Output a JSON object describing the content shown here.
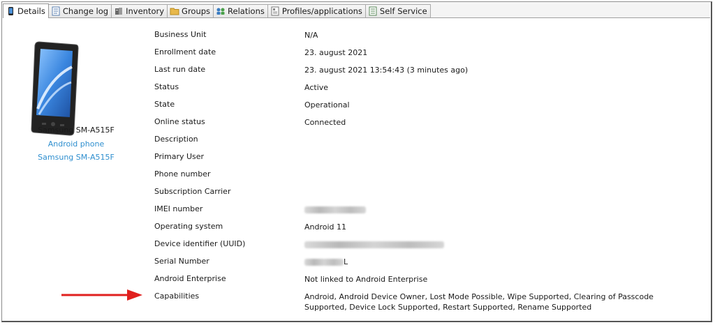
{
  "tabs": [
    {
      "label": "Details",
      "icon": "phone-icon",
      "active": true
    },
    {
      "label": "Change log",
      "icon": "document-icon"
    },
    {
      "label": "Inventory",
      "icon": "inventory-icon"
    },
    {
      "label": "Groups",
      "icon": "folder-icon"
    },
    {
      "label": "Relations",
      "icon": "relations-icon"
    },
    {
      "label": "Profiles/applications",
      "icon": "profiles-icon"
    },
    {
      "label": "Self Service",
      "icon": "self-service-icon"
    }
  ],
  "device": {
    "name": "Samsung SM-A515F",
    "type_link": "Android phone",
    "model_link": "Samsung SM-A515F"
  },
  "details": [
    {
      "label": "Business Unit",
      "value": "N/A"
    },
    {
      "label": "Enrollment date",
      "value": "23. august 2021"
    },
    {
      "label": "Last run date",
      "value": "23. august 2021 13:54:43 (3 minutes ago)"
    },
    {
      "label": "Status",
      "value": "Active"
    },
    {
      "label": "State",
      "value": "Operational"
    },
    {
      "label": "Online status",
      "value": "Connected"
    },
    {
      "label": "Description",
      "value": ""
    },
    {
      "label": "Primary User",
      "value": ""
    },
    {
      "label": "Phone number",
      "value": ""
    },
    {
      "label": "Subscription Carrier",
      "value": ""
    },
    {
      "label": "IMEI number",
      "value": "",
      "redacted": true
    },
    {
      "label": "Operating system",
      "value": "Android 11"
    },
    {
      "label": "Device identifier (UUID)",
      "value": "",
      "redacted": true
    },
    {
      "label": "Serial Number",
      "value": "L",
      "redacted_prefix": true
    },
    {
      "label": "Android Enterprise",
      "value": "Not linked to Android Enterprise"
    },
    {
      "label": "Capabilities",
      "value": "Android, Android Device Owner, Lost Mode Possible, Wipe Supported, Clearing of Passcode Supported, Device Lock Supported, Restart Supported, Rename Supported"
    }
  ],
  "colors": {
    "link": "#2f8fcf",
    "arrow": "#e0201e"
  }
}
